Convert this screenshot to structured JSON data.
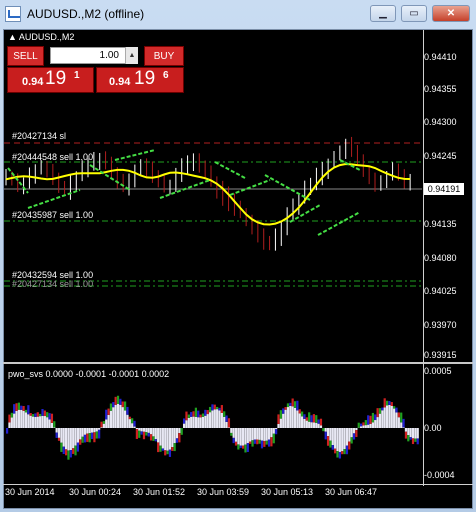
{
  "window": {
    "title": "AUDUSD.,M2 (offline)",
    "buttons": {
      "minimize": "▁",
      "maximize": "▭",
      "close": "✕"
    }
  },
  "chart": {
    "symbol_label": "AUDUSD.,M2",
    "trade_panel": {
      "sell_label": "SELL",
      "buy_label": "BUY",
      "lot_value": "1.00",
      "sell_price": {
        "prefix": "0.94",
        "big": "19",
        "sup": "1"
      },
      "buy_price": {
        "prefix": "0.94",
        "big": "19",
        "sup": "6"
      }
    },
    "price_scale": [
      "0.94410",
      "0.94355",
      "0.94300",
      "0.94245",
      "0.94191",
      "0.94135",
      "0.94080",
      "0.94025",
      "0.93970",
      "0.93915"
    ],
    "current_price": "0.94191",
    "order_lines": [
      {
        "label": "#20427134 sl",
        "color": "#b02020"
      },
      {
        "label": "#20444548 sell 1.00",
        "color": "#20a020"
      },
      {
        "label": "#20435987 sell 1.00",
        "color": "#20a020"
      },
      {
        "label": "#20432594 sell 1.00",
        "color": "#20a020"
      },
      {
        "label": "#20427134 sell 1.00",
        "color": "#20a020"
      }
    ],
    "indicator": {
      "label": "pwo_svs 0.0000 -0.0001 -0.0001 0.0002",
      "scale": [
        "0.0005",
        "0.00",
        "-0.0004"
      ]
    },
    "time_axis": [
      "30 Jun 2014",
      "30 Jun 00:24",
      "30 Jun 01:52",
      "30 Jun 03:59",
      "30 Jun 05:13",
      "30 Jun 06:47"
    ],
    "colors": {
      "background": "#000000",
      "bull_candle": "#ffffff",
      "bear_candle": "#b01e1e",
      "ma": "#ffff00",
      "trend": "#44dd44"
    }
  }
}
